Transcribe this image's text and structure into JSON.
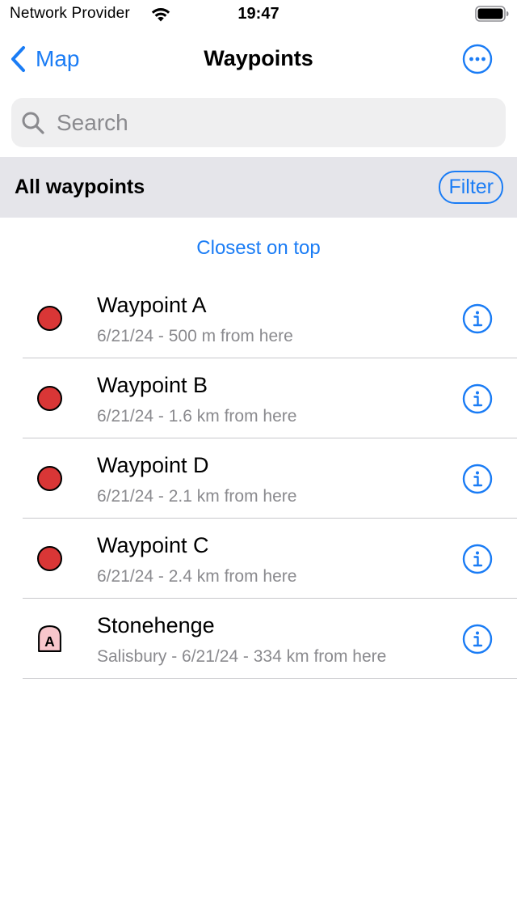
{
  "status_bar": {
    "carrier": "Network Provider",
    "time": "19:47"
  },
  "nav": {
    "back_label": "Map",
    "title": "Waypoints",
    "more_icon": "ellipsis-circle-icon"
  },
  "search": {
    "placeholder": "Search",
    "value": ""
  },
  "section": {
    "title": "All waypoints",
    "filter_label": "Filter"
  },
  "sort_label": "Closest on top",
  "colors": {
    "accent": "#1a7cf5",
    "waypoint_marker": "#d93636",
    "landmark_marker": "#f8c6cc"
  },
  "waypoints": [
    {
      "title": "Waypoint A",
      "subtitle": "6/21/24 - 500 m from here",
      "marker": "red-dot"
    },
    {
      "title": "Waypoint B",
      "subtitle": "6/21/24 - 1.6 km from here",
      "marker": "red-dot"
    },
    {
      "title": "Waypoint D",
      "subtitle": "6/21/24 - 2.1 km from here",
      "marker": "red-dot"
    },
    {
      "title": "Waypoint C",
      "subtitle": "6/21/24 - 2.4 km from here",
      "marker": "red-dot"
    },
    {
      "title": "Stonehenge",
      "subtitle": "Salisbury - 6/21/24 - 334 km from here",
      "marker": "landmark-pin",
      "marker_letter": "A"
    }
  ]
}
